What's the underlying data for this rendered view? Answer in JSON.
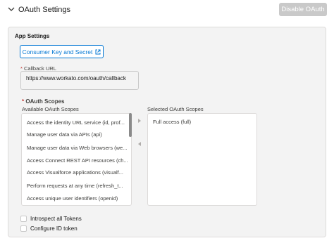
{
  "section": {
    "title": "OAuth Settings",
    "disable_label": "Disable OAuth"
  },
  "app_settings": {
    "heading": "App Settings",
    "consumer_key_button": "Consumer Key and Secret",
    "callback_label": "Callback URL",
    "callback_value": "https://www.workato.com/oauth/callback",
    "required_marker": "*"
  },
  "scopes": {
    "heading": "OAuth Scopes",
    "available_label": "Available OAuth Scopes",
    "selected_label": "Selected OAuth Scopes",
    "available": [
      "Access the identity URL service (id, prof...",
      "Manage user data via APIs (api)",
      "Manage user data via Web browsers (we...",
      "Access Connect REST API resources (ch...",
      "Access Visualforce applications (visualf...",
      "Perform requests at any time (refresh_t...",
      "Access unique user identifiers (openid)"
    ],
    "selected": [
      "Full access (full)"
    ]
  },
  "options": {
    "introspect_label": "Introspect all Tokens",
    "id_token_label": "Configure ID token"
  },
  "colors": {
    "accent": "#0176d3",
    "required": "#c23934",
    "disabled_button": "#c9c9c9"
  }
}
